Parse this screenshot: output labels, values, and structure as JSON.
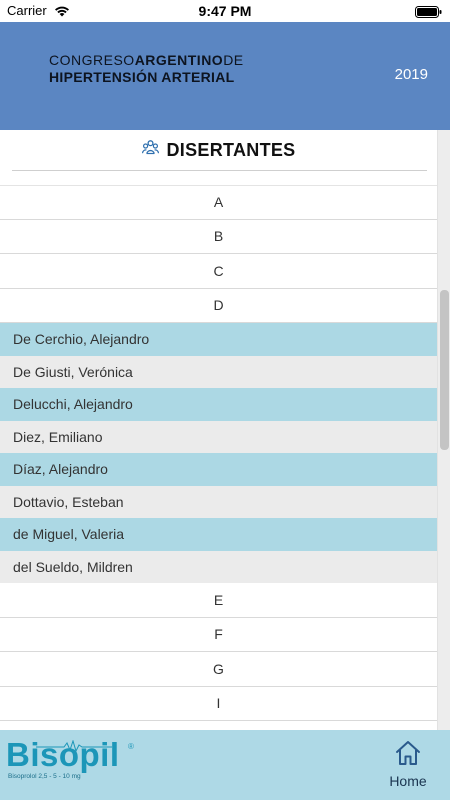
{
  "status_bar": {
    "carrier": "Carrier",
    "time": "9:47 PM"
  },
  "header": {
    "logo_line1_a": "CONGRESO",
    "logo_line1_b": "ARGENTINO",
    "logo_line1_c": "DE",
    "logo_line2": "HIPERTENSIÓN ARTERIAL",
    "year": "2019"
  },
  "section": {
    "title": "DISERTANTES",
    "icon": "people-icon"
  },
  "letters_before": [
    "A",
    "B",
    "C",
    "D"
  ],
  "names_d": [
    "De Cerchio, Alejandro",
    "De Giusti, Verónica",
    "Delucchi, Alejandro",
    "Diez, Emiliano",
    "Díaz, Alejandro",
    "Dottavio, Esteban",
    "de Miguel, Valeria",
    "del Sueldo, Mildren"
  ],
  "letters_after": [
    "E",
    "F",
    "G",
    "I"
  ],
  "footer": {
    "brand": "Bisopil",
    "brand_sub": "Bisoprolol 2,5 - 5 - 10 mg",
    "home_label": "Home",
    "home_icon": "home-icon"
  },
  "colors": {
    "header_bg": "#5b86c2",
    "row_highlight": "#acd8e4",
    "row_alt": "#ebebeb",
    "footer_bg": "#aed9e6",
    "brand": "#1c96b8"
  }
}
